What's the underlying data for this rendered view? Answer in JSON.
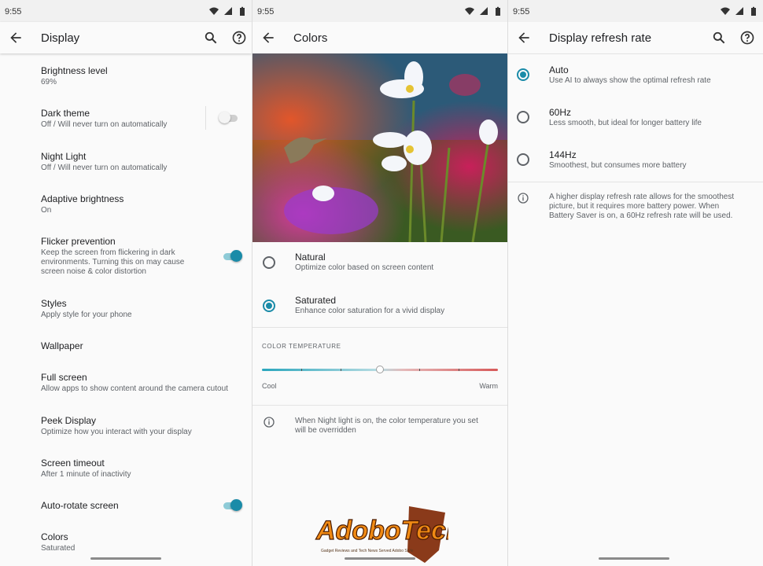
{
  "status_bar": {
    "time": "9:55"
  },
  "display_screen": {
    "title": "Display",
    "items": [
      {
        "title": "Brightness level",
        "summary": "69%"
      },
      {
        "title": "Dark theme",
        "summary": "Off / Will never turn on automatically",
        "toggle": false
      },
      {
        "title": "Night Light",
        "summary": "Off / Will never turn on automatically"
      },
      {
        "title": "Adaptive brightness",
        "summary": "On"
      },
      {
        "title": "Flicker prevention",
        "summary_lines": [
          "Keep the screen from flickering in dark",
          "environments. Turning this on may cause",
          "screen noise & color distortion"
        ],
        "toggle": true
      },
      {
        "title": "Styles",
        "summary": "Apply style for your phone"
      },
      {
        "title": "Wallpaper"
      },
      {
        "title": "Full screen",
        "summary": "Allow apps to show content around the camera cutout"
      },
      {
        "title": "Peek Display",
        "summary": "Optimize how you interact with your display"
      },
      {
        "title": "Screen timeout",
        "summary": "After 1 minute of inactivity"
      },
      {
        "title": "Auto-rotate screen",
        "toggle": true
      },
      {
        "title": "Colors",
        "summary": "Saturated"
      }
    ]
  },
  "colors_screen": {
    "title": "Colors",
    "options": [
      {
        "title": "Natural",
        "summary": "Optimize color based on screen content",
        "selected": false
      },
      {
        "title": "Saturated",
        "summary": "Enhance color saturation for a vivid display",
        "selected": true
      }
    ],
    "color_temperature": {
      "label": "COLOR TEMPERATURE",
      "min_label": "Cool",
      "max_label": "Warm",
      "value_fraction": 0.5
    },
    "info_lines": [
      "When Night light is on, the color temperature you set",
      "will be overridden"
    ]
  },
  "refresh_screen": {
    "title": "Display refresh rate",
    "options": [
      {
        "title": "Auto",
        "summary": "Use AI to always show the optimal refresh rate",
        "selected": true
      },
      {
        "title": "60Hz",
        "summary": "Less smooth, but ideal for longer battery life",
        "selected": false
      },
      {
        "title": "144Hz",
        "summary": "Smoothest, but consumes more battery",
        "selected": false
      }
    ],
    "info_lines": [
      "A higher display refresh rate allows for the smoothest",
      "picture, but it requires more battery power. When",
      "Battery Saver is on, a 60Hz refresh rate will be used."
    ]
  },
  "watermark": {
    "text": "AdoboTech",
    "tagline": "Gadget Reviews and Tech News Served Adobo Style"
  },
  "colors": {
    "accent": "#1a8ba8"
  }
}
